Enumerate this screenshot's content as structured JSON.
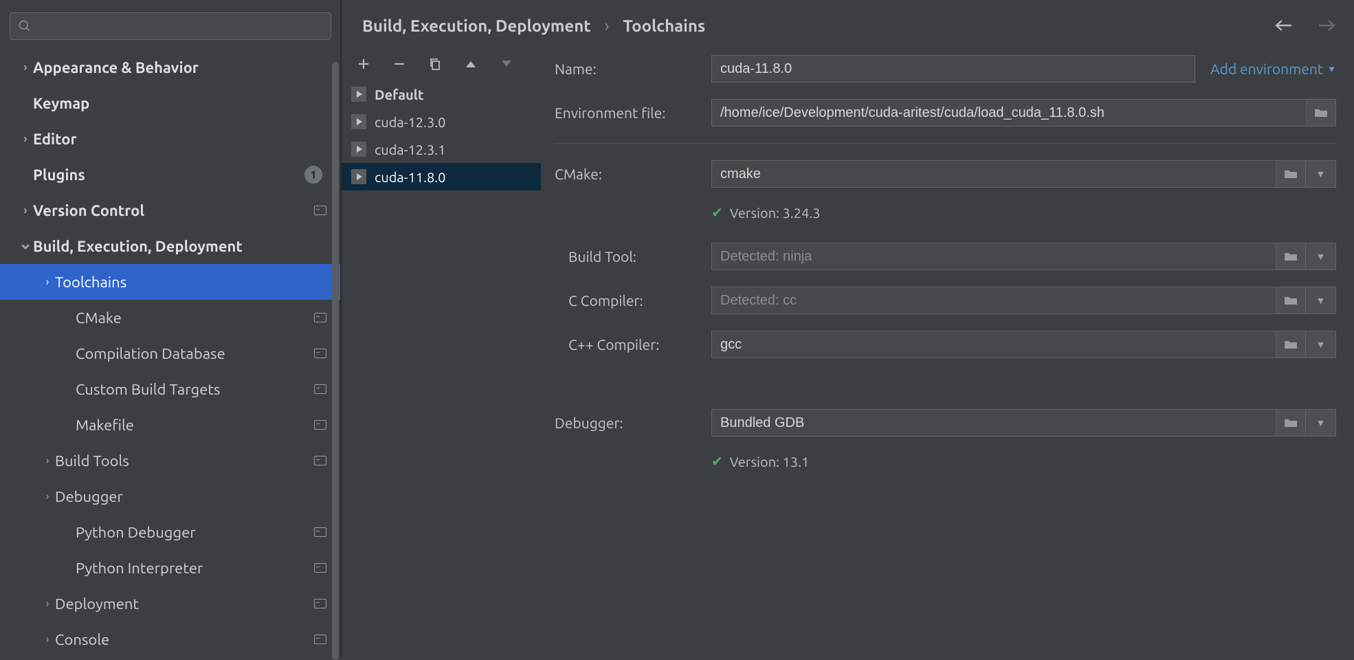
{
  "breadcrumb": {
    "parent": "Build, Execution, Deployment",
    "current": "Toolchains"
  },
  "search": {
    "placeholder": ""
  },
  "sidebar": {
    "items": [
      {
        "label": "Appearance & Behavior",
        "bold": true,
        "chev": "right"
      },
      {
        "label": "Keymap",
        "bold": true,
        "chev": ""
      },
      {
        "label": "Editor",
        "bold": true,
        "chev": "right"
      },
      {
        "label": "Plugins",
        "bold": true,
        "chev": "",
        "badge": "1"
      },
      {
        "label": "Version Control",
        "bold": true,
        "chev": "right",
        "project": true
      },
      {
        "label": "Build, Execution, Deployment",
        "bold": true,
        "chev": "down"
      },
      {
        "label": "Toolchains",
        "indent": 1,
        "chev": "right",
        "selected": true
      },
      {
        "label": "CMake",
        "indent": 2,
        "project": true
      },
      {
        "label": "Compilation Database",
        "indent": 2,
        "project": true
      },
      {
        "label": "Custom Build Targets",
        "indent": 2,
        "project": true
      },
      {
        "label": "Makefile",
        "indent": 2,
        "project": true
      },
      {
        "label": "Build Tools",
        "indent": 1,
        "chev": "right",
        "project": true
      },
      {
        "label": "Debugger",
        "indent": 1,
        "chev": "right"
      },
      {
        "label": "Python Debugger",
        "indent": 2,
        "project": true
      },
      {
        "label": "Python Interpreter",
        "indent": 2,
        "project": true
      },
      {
        "label": "Deployment",
        "indent": 1,
        "chev": "right",
        "project": true
      },
      {
        "label": "Console",
        "indent": 1,
        "chev": "right",
        "project": true
      }
    ]
  },
  "toolchains": {
    "items": [
      {
        "label": "Default",
        "bold": true
      },
      {
        "label": "cuda-12.3.0"
      },
      {
        "label": "cuda-12.3.1"
      },
      {
        "label": "cuda-11.8.0",
        "selected": true
      }
    ]
  },
  "form": {
    "name_label": "Name:",
    "name_value": "cuda-11.8.0",
    "add_env_label": "Add environment",
    "env_file_label": "Environment file:",
    "env_file_value": "/home/ice/Development/cuda-aritest/cuda/load_cuda_11.8.0.sh",
    "cmake_label": "CMake:",
    "cmake_value": "cmake",
    "cmake_version": "Version: 3.24.3",
    "build_tool_label": "Build Tool:",
    "build_tool_placeholder": "Detected: ninja",
    "c_compiler_label": "C Compiler:",
    "c_compiler_placeholder": "Detected: cc",
    "cpp_compiler_label": "C++ Compiler:",
    "cpp_compiler_value": "gcc",
    "debugger_label": "Debugger:",
    "debugger_value": "Bundled GDB",
    "debugger_version": "Version: 13.1"
  }
}
